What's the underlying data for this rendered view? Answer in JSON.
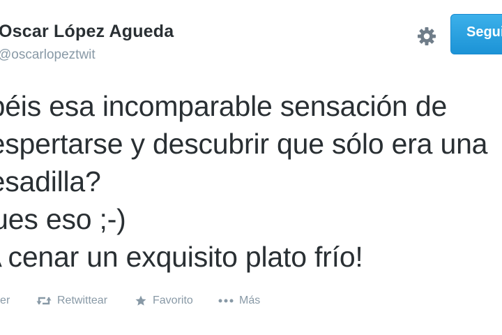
{
  "tweet": {
    "display_name": "Oscar López Agueda",
    "handle": "@oscarlopeztwit",
    "text_lines": [
      "abéis esa incomparable sensación de",
      "despertarse y descubrir que sólo era una",
      "pesadilla?",
      "Pues eso ;-)",
      "¡A cenar un exquisito plato frío!"
    ]
  },
  "header": {
    "follow_label": "Seguir",
    "settings_icon": "gear-icon"
  },
  "actions": {
    "reply_label": "Responder",
    "retweet_label": "Retwittear",
    "favorite_label": "Favorito",
    "more_label": "Más"
  },
  "colors": {
    "text": "#292f33",
    "muted": "#8899a6",
    "follow_button": "#2a9fe0",
    "follow_text": "#ffffff"
  }
}
